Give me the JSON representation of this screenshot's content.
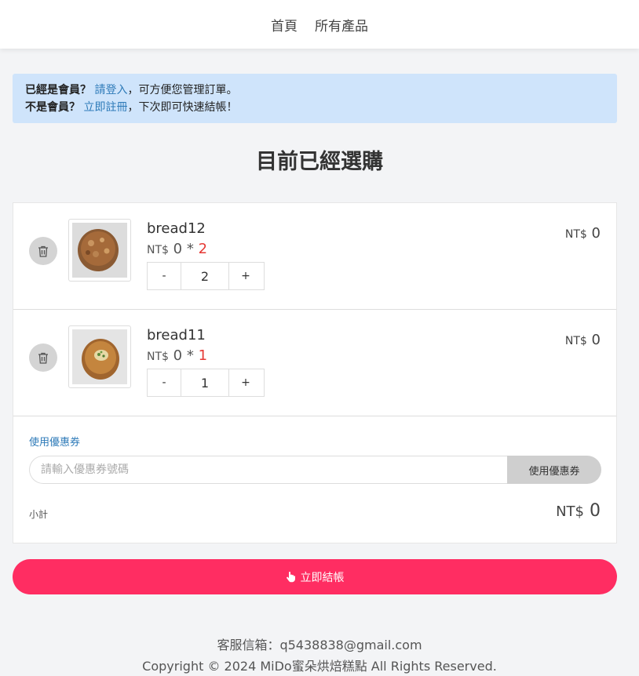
{
  "nav": {
    "home": "首頁",
    "products": "所有產品"
  },
  "alert": {
    "line1_prefix": "已經是會員？",
    "login_link": "請登入",
    "line1_suffix": "，可方便您管理訂單。",
    "line2_prefix": "不是會員？",
    "register_link": "立即註冊",
    "line2_suffix": "，下次即可快速結帳！"
  },
  "page_title": "目前已經選購",
  "cart": {
    "items": [
      {
        "name": "bread12",
        "currency": "NT$",
        "unit_price": "0",
        "times": "*",
        "qty": "2",
        "minus": "-",
        "plus": "+",
        "total": "0"
      },
      {
        "name": "bread11",
        "currency": "NT$",
        "unit_price": "0",
        "times": "*",
        "qty": "1",
        "minus": "-",
        "plus": "+",
        "total": "0"
      }
    ],
    "coupon_label": "使用優惠券",
    "coupon_placeholder": "請輸入優惠券號碼",
    "coupon_button": "使用優惠券",
    "subtotal_label": "小計",
    "subtotal_currency": "NT$",
    "subtotal_value": "0"
  },
  "checkout_label": "立即結帳",
  "footer": {
    "email_line": "客服信箱：q5438838@gmail.com",
    "copyright": "Copyright © 2024 MiDo蜜朵烘焙糕點 All Rights Reserved."
  },
  "colors": {
    "checkout": "#ff2d62",
    "alert_bg": "#cfe4fb",
    "link": "#2d7ab8",
    "qty_highlight": "#e53935"
  },
  "icons": [
    "trash-icon",
    "bread-image",
    "hand-pointer-icon"
  ]
}
